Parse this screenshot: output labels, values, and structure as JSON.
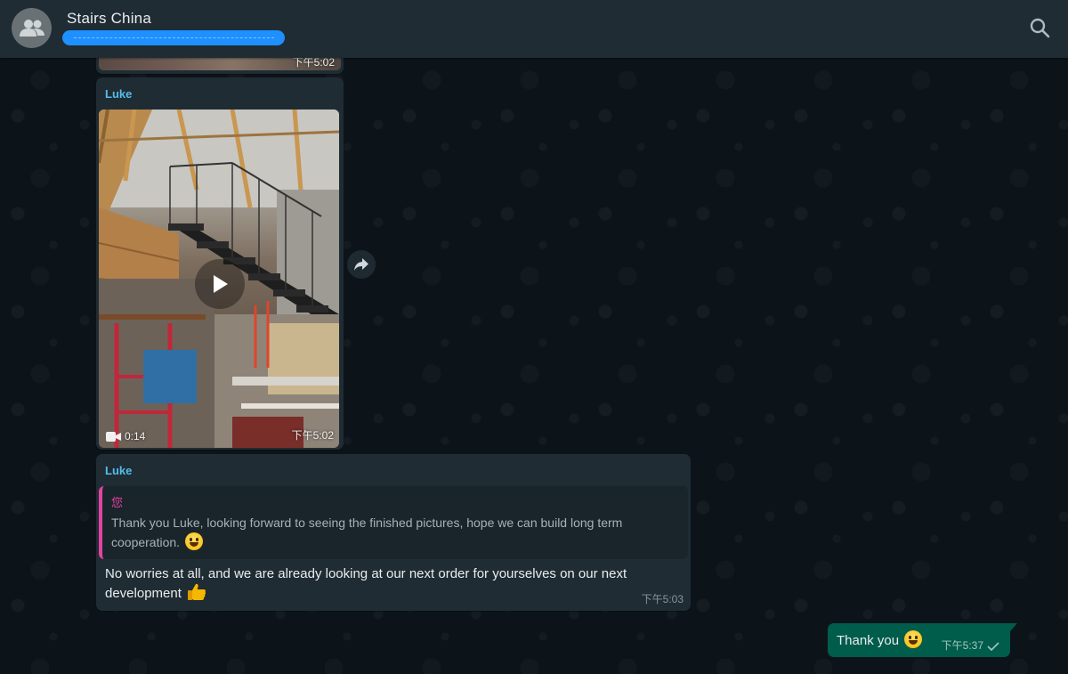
{
  "header": {
    "title": "Stairs China",
    "avatar_icon": "group-icon",
    "search_icon": "search-icon"
  },
  "messages": {
    "previous_media": {
      "time": "下午5:02"
    },
    "video": {
      "sender": "Luke",
      "duration": "0:14",
      "time": "下午5:02"
    },
    "reply": {
      "sender": "Luke",
      "quoted_author": "您",
      "quoted_text": "Thank you Luke, looking forward to seeing the finished pictures, hope we can build long term cooperation.",
      "text": "No worries at all, and we are already looking at our next order for yourselves on our next development",
      "time": "下午5:03"
    },
    "outgoing": {
      "text": "Thank you",
      "time": "下午5:37"
    }
  },
  "colors": {
    "header_bg": "#1f2c34",
    "incoming_bubble": "#202c33",
    "outgoing_bubble": "#005c4b",
    "sender_name": "#53bdeb",
    "quote_accent": "#e542a3",
    "subtitle_highlight": "#1e90ff"
  }
}
